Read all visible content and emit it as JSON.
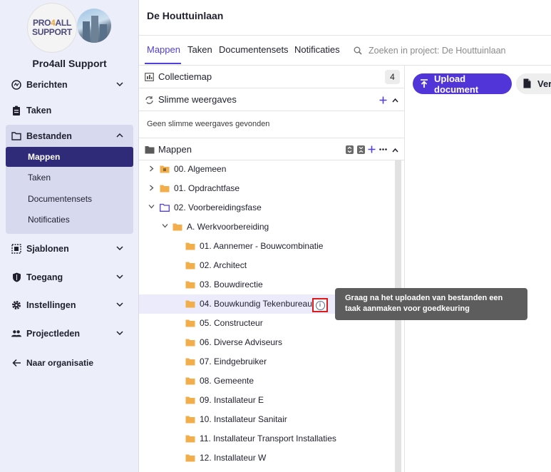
{
  "sidebar": {
    "logo_line1_a": "PRO",
    "logo_line1_b": "4",
    "logo_line1_c": "ALL",
    "logo_line2": "SUPPORT",
    "org_name": "Pro4all Support",
    "items": [
      {
        "label": "Berichten",
        "icon": "messages-icon"
      },
      {
        "label": "Taken",
        "icon": "clipboard-icon"
      },
      {
        "label": "Bestanden",
        "icon": "folder-icon"
      },
      {
        "label": "Sjablonen",
        "icon": "template-icon"
      },
      {
        "label": "Toegang",
        "icon": "shield-icon"
      },
      {
        "label": "Instellingen",
        "icon": "gear-icon"
      },
      {
        "label": "Projectleden",
        "icon": "people-icon"
      },
      {
        "label": "Naar organisatie",
        "icon": "arrow-left-icon"
      }
    ],
    "subitems": [
      "Mappen",
      "Taken",
      "Documentensets",
      "Notificaties"
    ]
  },
  "header": {
    "title": "De Houttuinlaan"
  },
  "tabs": [
    "Mappen",
    "Taken",
    "Documentensets",
    "Notificaties"
  ],
  "search": {
    "placeholder": "Zoeken in project: De Houttuinlaan"
  },
  "panel": {
    "collectie_label": "Collectiemap",
    "collectie_count": "4",
    "smart_label": "Slimme weergaves",
    "smart_empty": "Geen slimme weergaves gevonden",
    "folders_label": "Mappen"
  },
  "tree": [
    {
      "label": "00. Algemeen"
    },
    {
      "label": "01. Opdrachtfase"
    },
    {
      "label": "02. Voorbereidingsfase"
    },
    {
      "label": "A. Werkvoorbereiding"
    },
    {
      "label": "01. Aannemer - Bouwcombinatie"
    },
    {
      "label": "02. Architect"
    },
    {
      "label": "03. Bouwdirectie"
    },
    {
      "label": "04. Bouwkundig Tekenbureau"
    },
    {
      "label": "05. Constructeur"
    },
    {
      "label": "06. Diverse Adviseurs"
    },
    {
      "label": "07. Eindgebruiker"
    },
    {
      "label": "08. Gemeente"
    },
    {
      "label": "09. Installateur E"
    },
    {
      "label": "10. Installateur Sanitair"
    },
    {
      "label": "11. Installateur Transport Installaties"
    },
    {
      "label": "12. Installateur W"
    }
  ],
  "tooltip": {
    "text": "Graag na het uploaden van bestanden een taak aanmaken voor goedkeuring"
  },
  "actions": {
    "upload_label": "Upload document",
    "ver_label": "Ver"
  },
  "colors": {
    "accent": "#4f3fe0",
    "upload_bg": "#5235d8",
    "sidebar_bg": "#eceefa",
    "active_nav": "#2f2b78",
    "folder": "#f2ae4b",
    "folder_open": "#4f3fe0"
  }
}
